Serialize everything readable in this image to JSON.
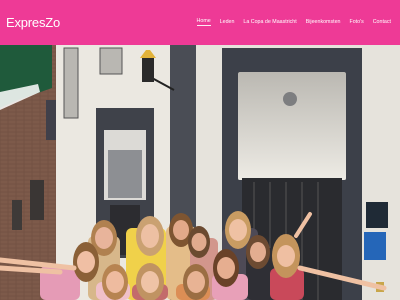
{
  "site": {
    "logo_text": "ExpresZo"
  },
  "nav": {
    "items": [
      {
        "label": "Home",
        "active": true
      },
      {
        "label": "Leden",
        "active": false
      },
      {
        "label": "La Copa de Maastricht",
        "active": false
      },
      {
        "label": "Bijeenkomsten",
        "active": false
      },
      {
        "label": "Foto's",
        "active": false
      },
      {
        "label": "Contact",
        "active": false
      }
    ]
  },
  "hero": {
    "image": "group-photo-women-in-front-of-building"
  },
  "colors": {
    "brand": "#ee3a96",
    "wall": "#e6e3dc",
    "frame": "#454954"
  }
}
